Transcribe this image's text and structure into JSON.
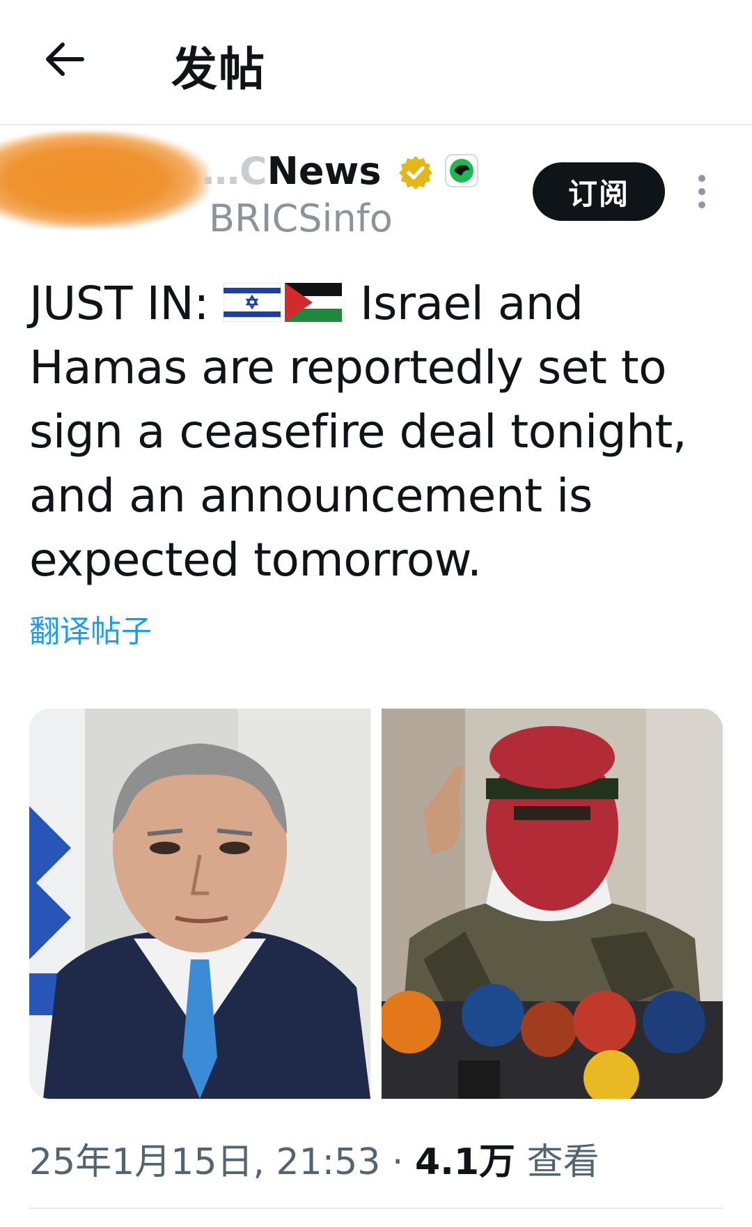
{
  "header": {
    "back_icon": "arrow-left-icon",
    "title": "发帖"
  },
  "author": {
    "display_name_partial": "News",
    "display_name_obscured": "…C",
    "handle_partial": "BRICSinfo",
    "badges": [
      "verified-gold-icon",
      "affiliate-icon"
    ],
    "subscribe_label": "订阅",
    "more_icon": "vertical-ellipsis-icon"
  },
  "tweet": {
    "line1_prefix": "JUST IN:",
    "line1_suffix": "Israel and",
    "line2": "Hamas are reportedly set to",
    "line3": "sign a ceasefire deal tonight,",
    "line4": "and an announcement is",
    "line5": "expected tomorrow.",
    "flags": [
      "israel-flag-icon",
      "palestine-flag-icon"
    ]
  },
  "translate_label": "翻译帖子",
  "media": [
    {
      "name": "portrait-man-suit"
    },
    {
      "name": "masked-speaker-microphones"
    }
  ],
  "meta": {
    "timestamp": "25年1月15日, 21:53",
    "separator": " · ",
    "views_count": "4.1万",
    "views_label": " 查看"
  },
  "colors": {
    "text": "#0f1419",
    "muted": "#536471",
    "link": "#1d9bf0",
    "button_bg": "#0f1419",
    "verified_gold": "#e2b719"
  }
}
